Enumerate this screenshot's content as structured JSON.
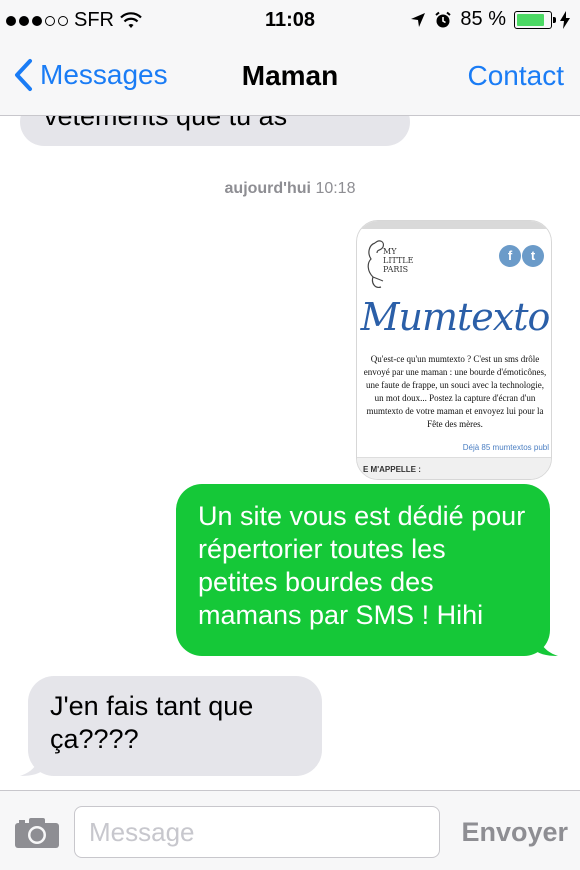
{
  "status_bar": {
    "carrier": "SFR",
    "time": "11:08",
    "battery_percent": "85 %",
    "battery_level": 0.85,
    "signal_bars_filled": 3,
    "signal_bars_total": 5
  },
  "nav": {
    "back_label": "Messages",
    "title": "Maman",
    "contact_label": "Contact"
  },
  "conversation": {
    "previous_message_fragment": "vêtements que tu as",
    "timestamp_day": "aujourd'hui",
    "timestamp_time": "10:18",
    "image_message": {
      "brand_lines": [
        "MY",
        "LITTLE",
        "PARIS"
      ],
      "title": "Mumtexto",
      "description": "Qu'est-ce qu'un mumtexto ? C'est un sms drôle envoyé par une maman : une bourde d'émoticônes, une faute de frappe, un souci avec la technologie, un mot doux... Postez la capture d'écran d'un mumtexto de votre maman et envoyez lui pour la Fête des mères.",
      "count_text": "Déjà 85 mumtextos publ",
      "bottom_text": "E M'APPELLE :"
    },
    "outgoing_message": "Un site vous est dédié pour répertorier toutes les petites bourdes des mamans par SMS ! Hihi",
    "incoming_message": "J'en fais tant que ça????"
  },
  "input_bar": {
    "placeholder": "Message",
    "send_label": "Envoyer"
  },
  "colors": {
    "ios_blue": "#1a7cf5",
    "sms_green": "#15c838",
    "incoming_gray": "#e5e5ea",
    "battery_green": "#4cd964"
  }
}
